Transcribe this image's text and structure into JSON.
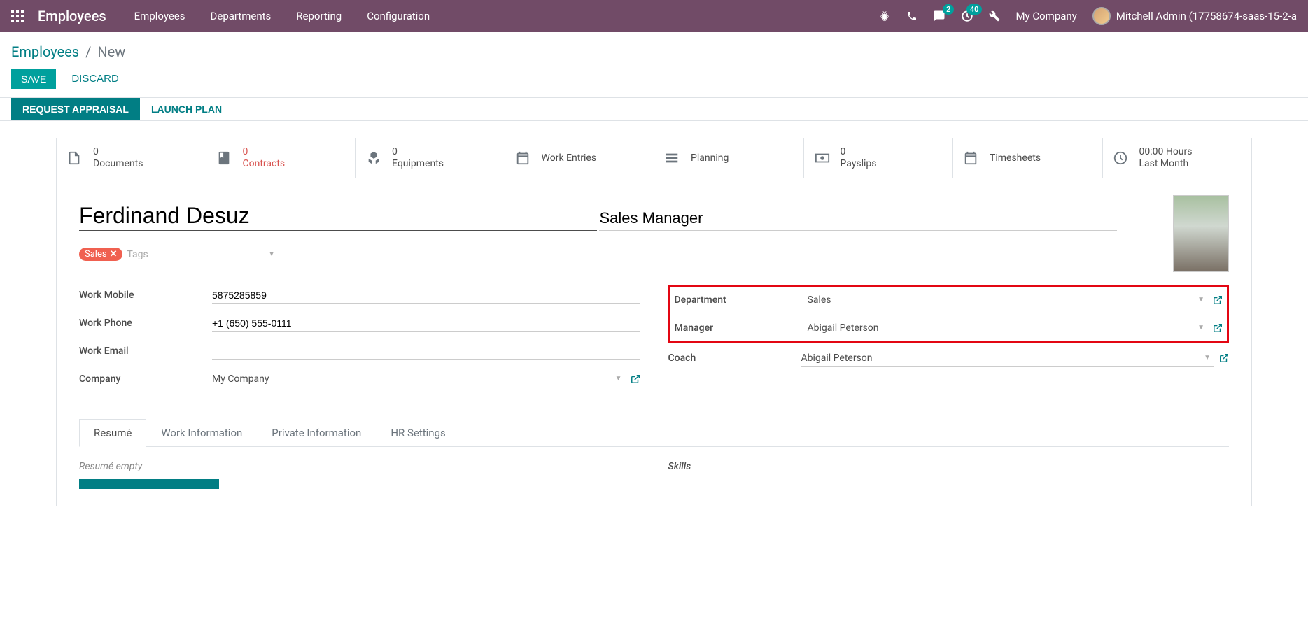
{
  "topbar": {
    "brand": "Employees",
    "menu": [
      "Employees",
      "Departments",
      "Reporting",
      "Configuration"
    ],
    "messaging_badge": "2",
    "activities_badge": "40",
    "company": "My Company",
    "user": "Mitchell Admin (17758674-saas-15-2-a"
  },
  "breadcrumb": {
    "root": "Employees",
    "current": "New"
  },
  "buttons": {
    "save": "SAVE",
    "discard": "DISCARD",
    "request_appraisal": "REQUEST APPRAISAL",
    "launch_plan": "LAUNCH PLAN"
  },
  "stats": {
    "documents": {
      "count": "0",
      "label": "Documents"
    },
    "contracts": {
      "count": "0",
      "label": "Contracts"
    },
    "equipments": {
      "count": "0",
      "label": "Equipments"
    },
    "work_entries": {
      "label": "Work Entries"
    },
    "planning": {
      "label": "Planning"
    },
    "payslips": {
      "count": "0",
      "label": "Payslips"
    },
    "timesheets": {
      "label": "Timesheets"
    },
    "last_month": {
      "count": "00:00 Hours",
      "label": "Last Month"
    }
  },
  "form": {
    "name": "Ferdinand Desuz",
    "job_title": "Sales Manager",
    "tag": "Sales",
    "tags_placeholder": "Tags",
    "labels": {
      "work_mobile": "Work Mobile",
      "work_phone": "Work Phone",
      "work_email": "Work Email",
      "company": "Company",
      "department": "Department",
      "manager": "Manager",
      "coach": "Coach"
    },
    "values": {
      "work_mobile": "5875285859",
      "work_phone": "+1 (650) 555-0111",
      "work_email": "",
      "company": "My Company",
      "department": "Sales",
      "manager": "Abigail Peterson",
      "coach": "Abigail Peterson"
    }
  },
  "tabs": [
    "Resumé",
    "Work Information",
    "Private Information",
    "HR Settings"
  ],
  "resume": {
    "empty": "Resumé empty",
    "skills_label": "Skills"
  }
}
